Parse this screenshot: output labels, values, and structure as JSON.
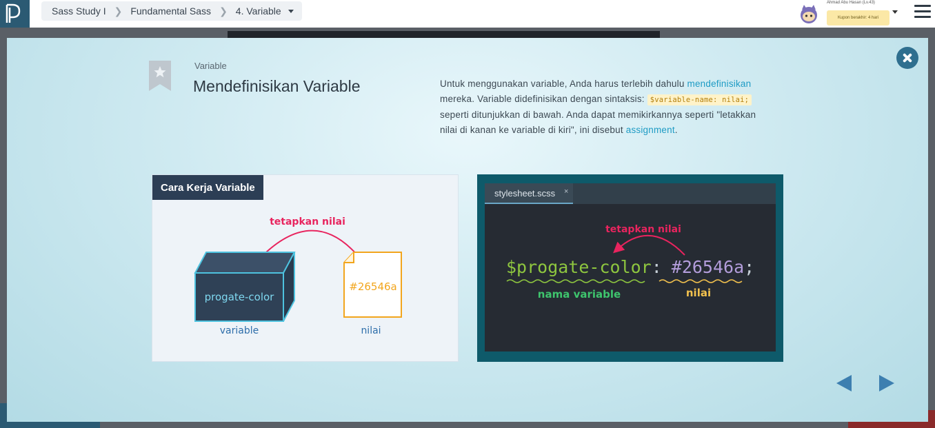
{
  "header": {
    "breadcrumb": [
      "Sass Study I",
      "Fundamental Sass",
      "4. Variable"
    ],
    "user_name": "Ahmad Abu Hasan (Lv.43)",
    "coupon": "Kupon berakhir: 4 hari"
  },
  "slide": {
    "label": "Variable",
    "title": "Mendefinisikan Variable",
    "description": {
      "part1": "Untuk menggunakan variable, Anda harus terlebih dahulu ",
      "link1": "mendefinisikan",
      "part2": " mereka. Variable didefinisikan dengan sintaksis: ",
      "code": "$variable-name: nilai;",
      "part3": " seperti ditunjukkan di bawah. Anda dapat memikirkannya seperti \"letakkan nilai di kanan ke variable di kiri\", ini disebut ",
      "link2": "assignment",
      "part4": "."
    },
    "diagram": {
      "title": "Cara Kerja Variable",
      "arrow_label": "tetapkan nilai",
      "box_text": "progate-color",
      "value_text": "#26546a",
      "variable_caption": "variable",
      "value_caption": "nilai"
    },
    "editor": {
      "tab_name": "stylesheet.scss",
      "tab_close": "×",
      "arrow_label": "tetapkan nilai",
      "var_name": "$progate-color",
      "colon": ":",
      "value": "#26546a",
      "semicolon": ";",
      "var_caption": "nama variable",
      "value_caption": "nilai"
    }
  },
  "colors": {
    "accent": "#1d9bc4",
    "arrow": "#e8245e",
    "box": "#2f4156",
    "value_orange": "#f2a51c",
    "editor_green": "#8ec63f",
    "editor_purple": "#b39ddb"
  }
}
